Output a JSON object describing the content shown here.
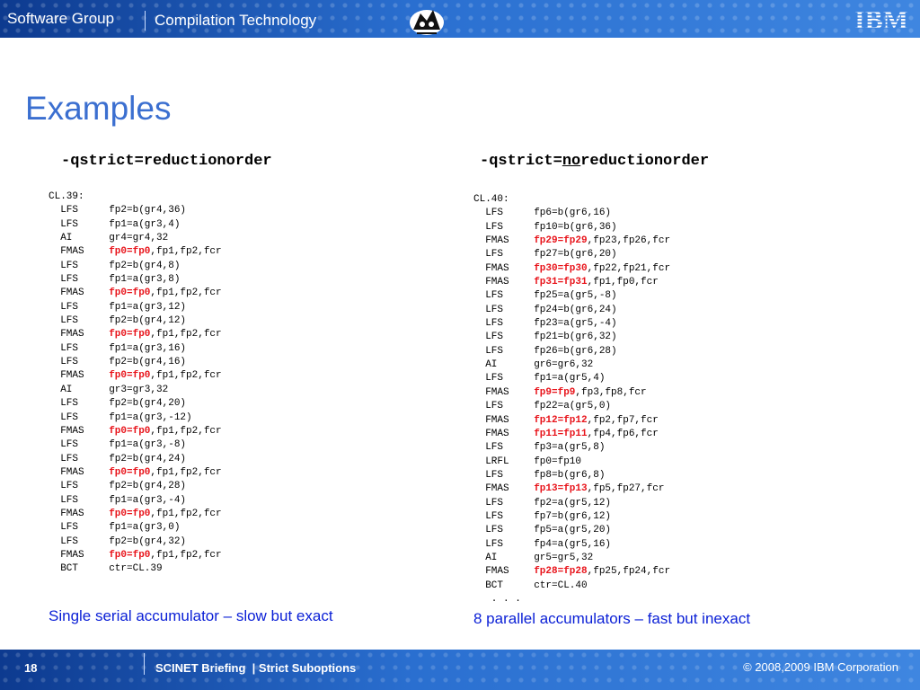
{
  "header": {
    "brand": "Software Group",
    "separator": "|",
    "section": "Compilation Technology",
    "logo": "IBM"
  },
  "slide": {
    "title": "Examples",
    "left": {
      "heading": "-qstrict=reductionorder",
      "code": [
        {
          "text": "CL.39:"
        },
        {
          "op": "LFS",
          "arg": "fp2=b(gr4,36)"
        },
        {
          "op": "LFS",
          "arg": "fp1=a(gr3,4)"
        },
        {
          "op": "AI",
          "arg": "gr4=gr4,32"
        },
        {
          "op": "FMAS",
          "hl": "fp0=fp0",
          "rest": ",fp1,fp2,fcr"
        },
        {
          "op": "LFS",
          "arg": "fp2=b(gr4,8)"
        },
        {
          "op": "LFS",
          "arg": "fp1=a(gr3,8)"
        },
        {
          "op": "FMAS",
          "hl": "fp0=fp0",
          "rest": ",fp1,fp2,fcr"
        },
        {
          "op": "LFS",
          "arg": "fp1=a(gr3,12)"
        },
        {
          "op": "LFS",
          "arg": "fp2=b(gr4,12)"
        },
        {
          "op": "FMAS",
          "hl": "fp0=fp0",
          "rest": ",fp1,fp2,fcr"
        },
        {
          "op": "LFS",
          "arg": "fp1=a(gr3,16)"
        },
        {
          "op": "LFS",
          "arg": "fp2=b(gr4,16)"
        },
        {
          "op": "FMAS",
          "hl": "fp0=fp0",
          "rest": ",fp1,fp2,fcr"
        },
        {
          "op": "AI",
          "arg": "gr3=gr3,32"
        },
        {
          "op": "LFS",
          "arg": "fp2=b(gr4,20)"
        },
        {
          "op": "LFS",
          "arg": "fp1=a(gr3,-12)"
        },
        {
          "op": "FMAS",
          "hl": "fp0=fp0",
          "rest": ",fp1,fp2,fcr"
        },
        {
          "op": "LFS",
          "arg": "fp1=a(gr3,-8)"
        },
        {
          "op": "LFS",
          "arg": "fp2=b(gr4,24)"
        },
        {
          "op": "FMAS",
          "hl": "fp0=fp0",
          "rest": ",fp1,fp2,fcr"
        },
        {
          "op": "LFS",
          "arg": "fp2=b(gr4,28)"
        },
        {
          "op": "LFS",
          "arg": "fp1=a(gr3,-4)"
        },
        {
          "op": "FMAS",
          "hl": "fp0=fp0",
          "rest": ",fp1,fp2,fcr"
        },
        {
          "op": "LFS",
          "arg": "fp1=a(gr3,0)"
        },
        {
          "op": "LFS",
          "arg": "fp2=b(gr4,32)"
        },
        {
          "op": "FMAS",
          "hl": "fp0=fp0",
          "rest": ",fp1,fp2,fcr"
        },
        {
          "op": "BCT",
          "arg": "ctr=CL.39"
        }
      ],
      "caption": "Single serial accumulator – slow but exact"
    },
    "right": {
      "heading_prefix": "-qstrict=",
      "heading_underlined": "no",
      "heading_suffix": "reductionorder",
      "code": [
        {
          "text": "CL.40:"
        },
        {
          "op": "LFS",
          "arg": "fp6=b(gr6,16)"
        },
        {
          "op": "LFS",
          "arg": "fp10=b(gr6,36)"
        },
        {
          "op": "FMAS",
          "hl": "fp29=fp29",
          "rest": ",fp23,fp26,fcr"
        },
        {
          "op": "LFS",
          "arg": "fp27=b(gr6,20)"
        },
        {
          "op": "FMAS",
          "hl": "fp30=fp30",
          "rest": ",fp22,fp21,fcr"
        },
        {
          "op": "FMAS",
          "hl": "fp31=fp31",
          "rest": ",fp1,fp0,fcr"
        },
        {
          "op": "LFS",
          "arg": "fp25=a(gr5,-8)"
        },
        {
          "op": "LFS",
          "arg": "fp24=b(gr6,24)"
        },
        {
          "op": "LFS",
          "arg": "fp23=a(gr5,-4)"
        },
        {
          "op": "LFS",
          "arg": "fp21=b(gr6,32)"
        },
        {
          "op": "LFS",
          "arg": "fp26=b(gr6,28)"
        },
        {
          "op": "AI",
          "arg": "gr6=gr6,32"
        },
        {
          "op": "LFS",
          "arg": "fp1=a(gr5,4)"
        },
        {
          "op": "FMAS",
          "hl": "fp9=fp9",
          "rest": ",fp3,fp8,fcr"
        },
        {
          "op": "LFS",
          "arg": "fp22=a(gr5,0)"
        },
        {
          "op": "FMAS",
          "hl": "fp12=fp12",
          "rest": ",fp2,fp7,fcr"
        },
        {
          "op": "FMAS",
          "hl": "fp11=fp11",
          "rest": ",fp4,fp6,fcr"
        },
        {
          "op": "LFS",
          "arg": "fp3=a(gr5,8)"
        },
        {
          "op": "LRFL",
          "arg": "fp0=fp10"
        },
        {
          "op": "LFS",
          "arg": "fp8=b(gr6,8)"
        },
        {
          "op": "FMAS",
          "hl": "fp13=fp13",
          "rest": ",fp5,fp27,fcr"
        },
        {
          "op": "LFS",
          "arg": "fp2=a(gr5,12)"
        },
        {
          "op": "LFS",
          "arg": "fp7=b(gr6,12)"
        },
        {
          "op": "LFS",
          "arg": "fp5=a(gr5,20)"
        },
        {
          "op": "LFS",
          "arg": "fp4=a(gr5,16)"
        },
        {
          "op": "AI",
          "arg": "gr5=gr5,32"
        },
        {
          "op": "FMAS",
          "hl": "fp28=fp28",
          "rest": ",fp25,fp24,fcr"
        },
        {
          "op": "BCT",
          "arg": "ctr=CL.40"
        },
        {
          "text": "   . . ."
        }
      ],
      "caption": "8 parallel accumulators – fast but inexact"
    }
  },
  "footer": {
    "page": "18",
    "course": "SCINET Briefing",
    "separator": "|",
    "topic": "Strict Suboptions",
    "copyright": "© 2008,2009 IBM Corporation"
  },
  "colors": {
    "header_blue": "#2a6fd0",
    "title_blue": "#3b6fd0",
    "highlight_red": "#e8141b",
    "caption_blue": "#0a1fd6"
  },
  "icons": [
    "mascot-icon",
    "ibm-logo-icon"
  ]
}
